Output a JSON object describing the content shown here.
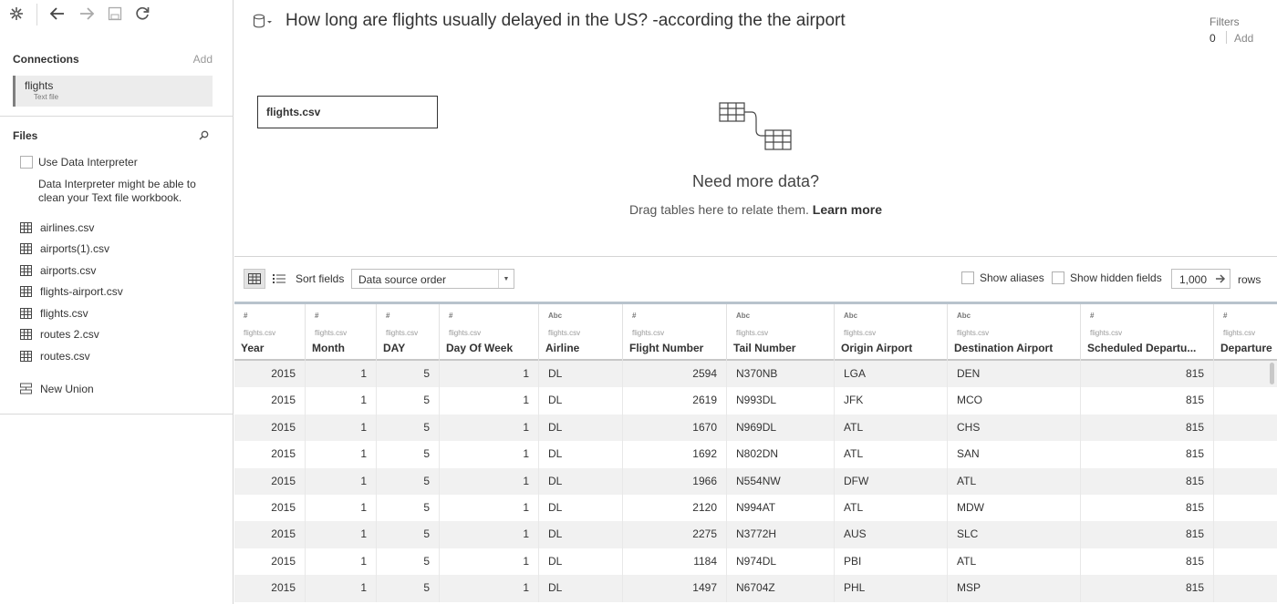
{
  "sidebar": {
    "connections": {
      "title": "Connections",
      "add": "Add"
    },
    "connection": {
      "name": "flights",
      "type": "Text file"
    },
    "files": {
      "title": "Files"
    },
    "interpreter": {
      "label": "Use Data Interpreter",
      "description": "Data Interpreter might be able to clean your Text file workbook."
    },
    "file_list": [
      "airlines.csv",
      "airports(1).csv",
      "airports.csv",
      "flights-airport.csv",
      "flights.csv",
      "routes 2.csv",
      "routes.csv"
    ],
    "new_union": "New Union"
  },
  "canvas": {
    "title": "How long are flights usually delayed in the US? -according the the airport",
    "filters": {
      "label": "Filters",
      "count": "0",
      "add": "Add"
    },
    "table_name": "flights.csv",
    "need_more": "Need more data?",
    "drag_hint": "Drag tables here to relate them.",
    "learn_more": "Learn more"
  },
  "grid_toolbar": {
    "sort_label": "Sort fields",
    "sort_value": "Data source order",
    "show_aliases": "Show aliases",
    "show_hidden": "Show hidden fields",
    "rows_value": "1,000",
    "rows_label": "rows"
  },
  "columns": [
    {
      "type": "#",
      "source": "flights.csv",
      "name": "Year"
    },
    {
      "type": "#",
      "source": "flights.csv",
      "name": "Month"
    },
    {
      "type": "#",
      "source": "flights.csv",
      "name": "DAY"
    },
    {
      "type": "#",
      "source": "flights.csv",
      "name": "Day Of Week"
    },
    {
      "type": "Abc",
      "source": "flights.csv",
      "name": "Airline"
    },
    {
      "type": "#",
      "source": "flights.csv",
      "name": "Flight Number"
    },
    {
      "type": "Abc",
      "source": "flights.csv",
      "name": "Tail Number"
    },
    {
      "type": "Abc",
      "source": "flights.csv",
      "name": "Origin Airport"
    },
    {
      "type": "Abc",
      "source": "flights.csv",
      "name": "Destination Airport"
    },
    {
      "type": "#",
      "source": "flights.csv",
      "name": "Scheduled Departu..."
    },
    {
      "type": "#",
      "source": "flights.csv",
      "name": "Departure"
    }
  ],
  "rows": [
    [
      "2015",
      "1",
      "5",
      "1",
      "DL",
      "2594",
      "N370NB",
      "LGA",
      "DEN",
      "815",
      ""
    ],
    [
      "2015",
      "1",
      "5",
      "1",
      "DL",
      "2619",
      "N993DL",
      "JFK",
      "MCO",
      "815",
      ""
    ],
    [
      "2015",
      "1",
      "5",
      "1",
      "DL",
      "1670",
      "N969DL",
      "ATL",
      "CHS",
      "815",
      ""
    ],
    [
      "2015",
      "1",
      "5",
      "1",
      "DL",
      "1692",
      "N802DN",
      "ATL",
      "SAN",
      "815",
      ""
    ],
    [
      "2015",
      "1",
      "5",
      "1",
      "DL",
      "1966",
      "N554NW",
      "DFW",
      "ATL",
      "815",
      ""
    ],
    [
      "2015",
      "1",
      "5",
      "1",
      "DL",
      "2120",
      "N994AT",
      "ATL",
      "MDW",
      "815",
      ""
    ],
    [
      "2015",
      "1",
      "5",
      "1",
      "DL",
      "2275",
      "N3772H",
      "AUS",
      "SLC",
      "815",
      ""
    ],
    [
      "2015",
      "1",
      "5",
      "1",
      "DL",
      "1184",
      "N974DL",
      "PBI",
      "ATL",
      "815",
      ""
    ],
    [
      "2015",
      "1",
      "5",
      "1",
      "DL",
      "1497",
      "N6704Z",
      "PHL",
      "MSP",
      "815",
      ""
    ]
  ]
}
